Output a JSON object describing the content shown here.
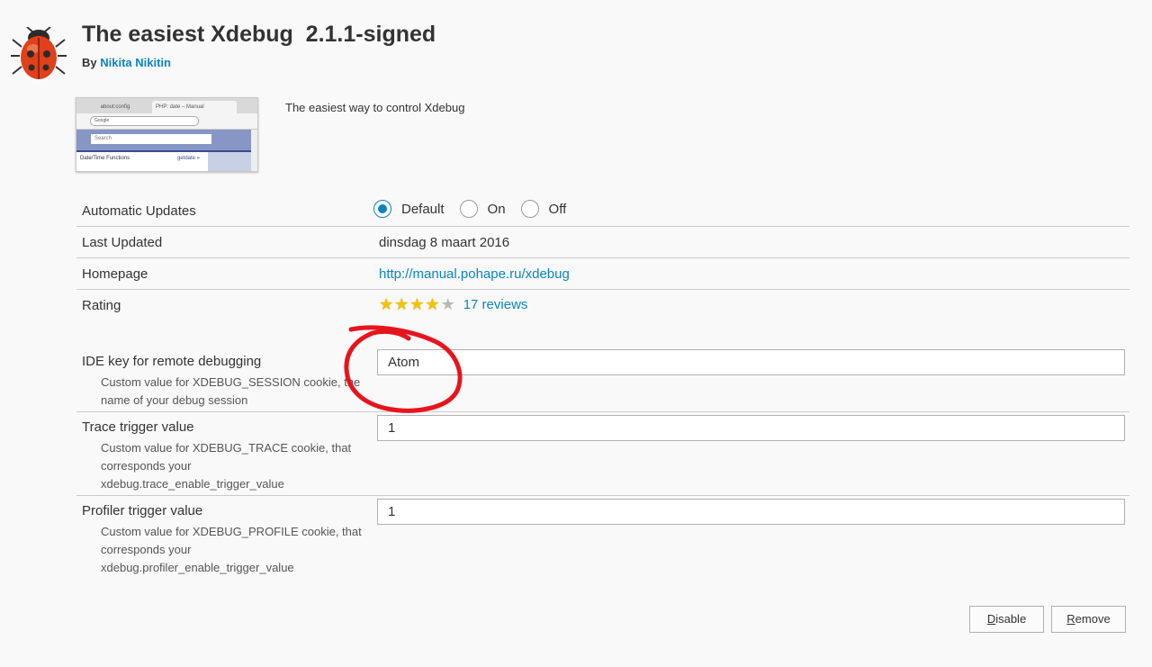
{
  "addon": {
    "icon": "ladybug-icon",
    "title": "The easiest Xdebug  2.1.1-signed",
    "by_label": "By",
    "author": "Nikita Nikitin",
    "description": "The easiest way to control Xdebug"
  },
  "preview": {
    "tab1": "about:config",
    "tab2": "PHP: date – Manual",
    "url": "Google",
    "search": "Search",
    "left_text": "Date/Time Functions",
    "right_text": "getdate »"
  },
  "details": {
    "updates": {
      "label": "Automatic Updates",
      "options": [
        "Default",
        "On",
        "Off"
      ],
      "selected": "Default"
    },
    "last_updated": {
      "label": "Last Updated",
      "value": "dinsdag 8 maart 2016"
    },
    "homepage": {
      "label": "Homepage",
      "value": "http://manual.pohape.ru/xdebug"
    },
    "rating": {
      "label": "Rating",
      "stars": 4,
      "max": 5,
      "reviews": "17 reviews"
    }
  },
  "prefs": [
    {
      "label": "IDE key for remote debugging",
      "help": "Custom value for XDEBUG_SESSION cookie, the name of your debug session",
      "value": "Atom"
    },
    {
      "label": "Trace trigger value",
      "help": "Custom value for XDEBUG_TRACE cookie, that corresponds your xdebug.trace_enable_trigger_value",
      "value": "1"
    },
    {
      "label": "Profiler trigger value",
      "help": "Custom value for XDEBUG_PROFILE cookie, that corresponds your xdebug.profiler_enable_trigger_value",
      "value": "1"
    }
  ],
  "buttons": {
    "disable_accesskey": "D",
    "disable_rest": "isable",
    "remove_accesskey": "R",
    "remove_rest": "emove"
  },
  "annotation_color": "#e8141c",
  "accent_color": "#0a84c1"
}
